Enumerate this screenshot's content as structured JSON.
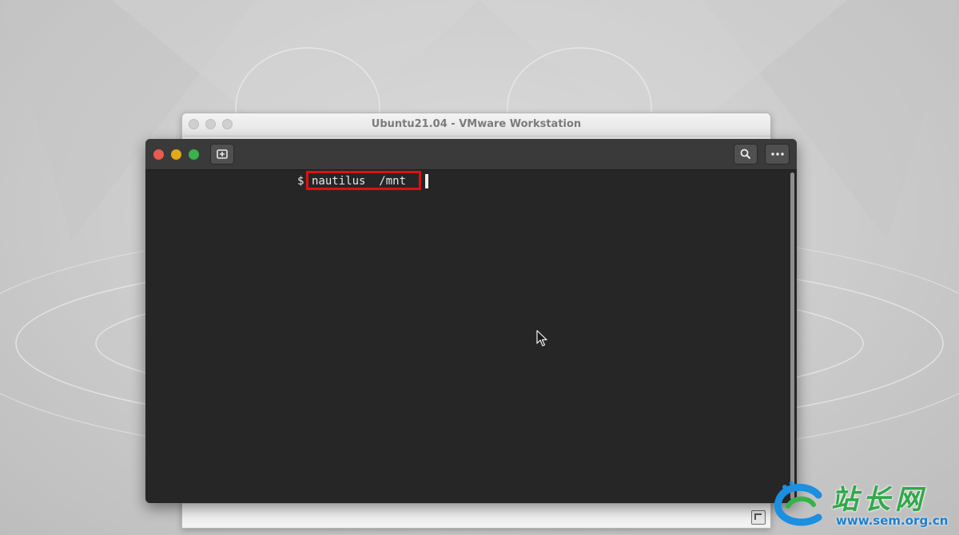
{
  "vmware": {
    "title": "Ubuntu21.04 - VMware Workstation"
  },
  "terminal": {
    "prompt_symbol": "$",
    "command": "nautilus  /mnt",
    "highlight_color": "#e01010"
  },
  "watermark": {
    "logo_text": "站长网",
    "url": "www.sem.org.cn"
  },
  "icons": {
    "new_tab": "new-tab-icon",
    "search": "search-icon",
    "menu": "more-menu-icon",
    "pointer": "mouse-pointer-icon"
  },
  "colors": {
    "close": "#e95b4f",
    "minimize": "#e0a91b",
    "maximize": "#3cb04c",
    "terminal_bg": "#262626"
  }
}
